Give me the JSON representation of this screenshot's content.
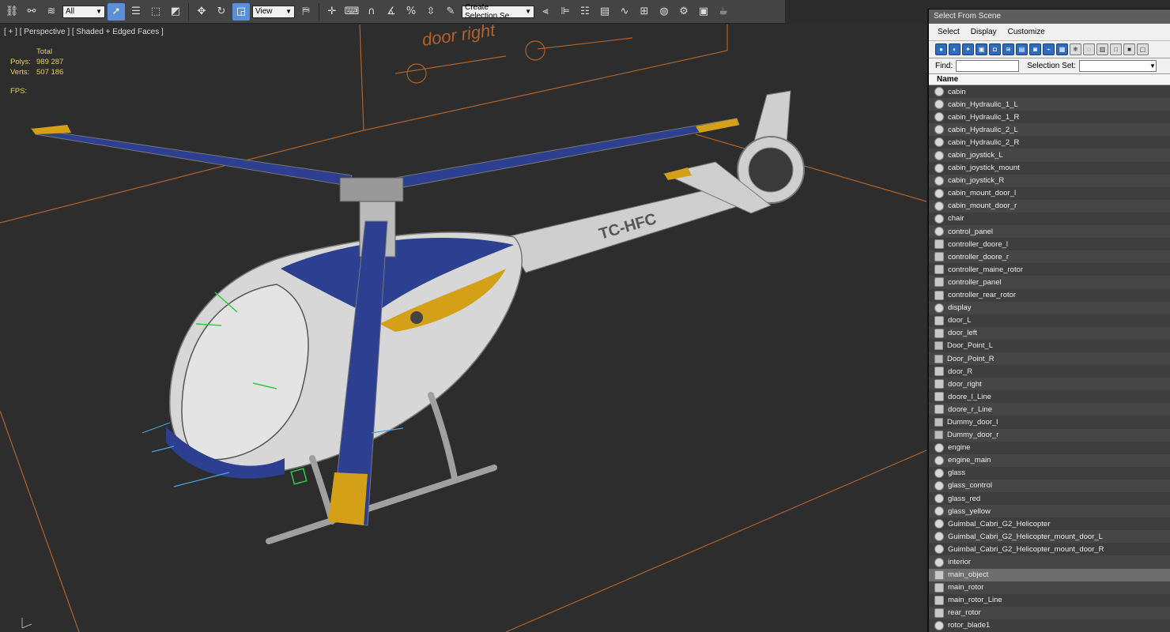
{
  "toolbar": {
    "filter_value": "All",
    "coord_value": "View",
    "selection_set_placeholder": "Create Selection Se"
  },
  "viewport": {
    "label": "[ + ] [ Perspective ] [ Shaded + Edged Faces ]",
    "stats": {
      "total_label": "Total",
      "polys_label": "Polys:",
      "polys_value": "989 287",
      "verts_label": "Verts:",
      "verts_value": "507 186",
      "fps_label": "FPS:"
    },
    "text_decal": "door right",
    "tail_text": "TC-HFC"
  },
  "scene_panel": {
    "title": "Select From Scene",
    "menu": [
      "Select",
      "Display",
      "Customize"
    ],
    "find_label": "Find:",
    "selection_set_label": "Selection Set:",
    "column_header": "Name",
    "items": [
      {
        "name": "cabin",
        "icon": "sphere"
      },
      {
        "name": "cabin_Hydraulic_1_L",
        "icon": "sphere"
      },
      {
        "name": "cabin_Hydraulic_1_R",
        "icon": "sphere"
      },
      {
        "name": "cabin_Hydraulic_2_L",
        "icon": "sphere"
      },
      {
        "name": "cabin_Hydraulic_2_R",
        "icon": "sphere"
      },
      {
        "name": "cabin_joystick_L",
        "icon": "sphere"
      },
      {
        "name": "cabin_joystick_mount",
        "icon": "sphere"
      },
      {
        "name": "cabin_joystick_R",
        "icon": "sphere"
      },
      {
        "name": "cabin_mount_door_l",
        "icon": "sphere"
      },
      {
        "name": "cabin_mount_door_r",
        "icon": "sphere"
      },
      {
        "name": "chair",
        "icon": "sphere"
      },
      {
        "name": "control_panel",
        "icon": "sphere"
      },
      {
        "name": "controller_doore_l",
        "icon": "multi"
      },
      {
        "name": "controller_doore_r",
        "icon": "multi"
      },
      {
        "name": "controller_maine_rotor",
        "icon": "multi"
      },
      {
        "name": "controller_panel",
        "icon": "multi"
      },
      {
        "name": "controller_rear_rotor",
        "icon": "multi"
      },
      {
        "name": "display",
        "icon": "sphere"
      },
      {
        "name": "door_L",
        "icon": "multi"
      },
      {
        "name": "door_left",
        "icon": "multi"
      },
      {
        "name": "Door_Point_L",
        "icon": "dummy"
      },
      {
        "name": "Door_Point_R",
        "icon": "dummy"
      },
      {
        "name": "door_R",
        "icon": "multi"
      },
      {
        "name": "door_right",
        "icon": "multi"
      },
      {
        "name": "doore_l_Line",
        "icon": "multi"
      },
      {
        "name": "doore_r_Line",
        "icon": "multi"
      },
      {
        "name": "Dummy_door_l",
        "icon": "dummy"
      },
      {
        "name": "Dummy_door_r",
        "icon": "dummy"
      },
      {
        "name": "engine",
        "icon": "sphere"
      },
      {
        "name": "engine_main",
        "icon": "sphere"
      },
      {
        "name": "glass",
        "icon": "sphere"
      },
      {
        "name": "glass_control",
        "icon": "sphere"
      },
      {
        "name": "glass_red",
        "icon": "sphere"
      },
      {
        "name": "glass_yellow",
        "icon": "sphere"
      },
      {
        "name": "Guimbal_Cabri_G2_Helicopter",
        "icon": "sphere"
      },
      {
        "name": "Guimbal_Cabri_G2_Helicopter_mount_door_L",
        "icon": "sphere"
      },
      {
        "name": "Guimbal_Cabri_G2_Helicopter_mount_door_R",
        "icon": "sphere"
      },
      {
        "name": "interior",
        "icon": "sphere"
      },
      {
        "name": "main_object",
        "icon": "multi",
        "selected": true
      },
      {
        "name": "main_rotor",
        "icon": "multi"
      },
      {
        "name": "main_rotor_Line",
        "icon": "multi"
      },
      {
        "name": "rear_rotor",
        "icon": "multi"
      },
      {
        "name": "rotor_blade1",
        "icon": "sphere"
      }
    ]
  }
}
